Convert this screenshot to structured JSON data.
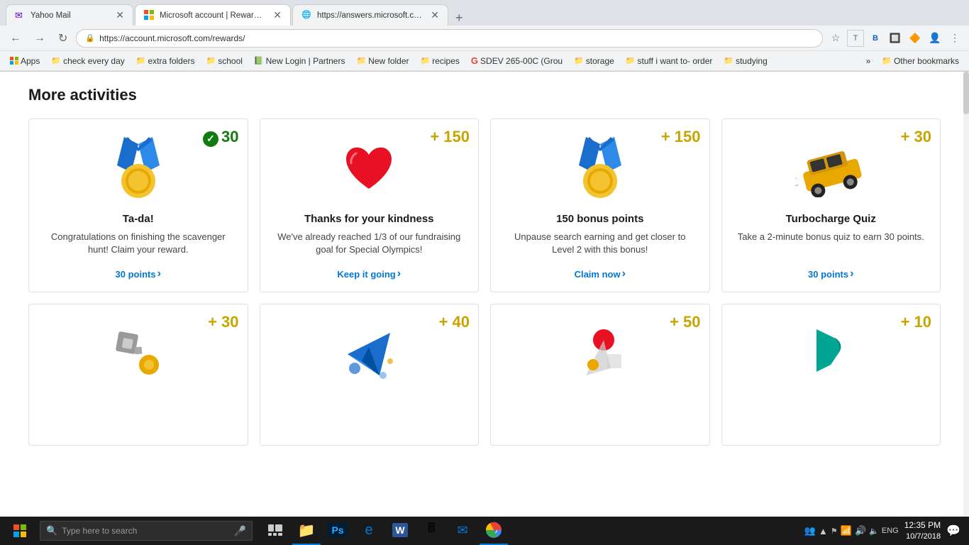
{
  "browser": {
    "tabs": [
      {
        "id": "tab1",
        "title": "Yahoo Mail",
        "favicon": "✉",
        "active": false
      },
      {
        "id": "tab2",
        "title": "Microsoft account | Rewards Das",
        "favicon": "⊞",
        "active": true
      },
      {
        "id": "tab3",
        "title": "https://answers.microsoft.com/e",
        "favicon": "🌐",
        "active": false
      }
    ],
    "address": "https://account.microsoft.com/rewards/",
    "bookmarks": [
      {
        "id": "bm1",
        "label": "Apps",
        "icon": "⊞"
      },
      {
        "id": "bm2",
        "label": "check every day",
        "icon": "📁"
      },
      {
        "id": "bm3",
        "label": "extra folders",
        "icon": "📁"
      },
      {
        "id": "bm4",
        "label": "school",
        "icon": "📁"
      },
      {
        "id": "bm5",
        "label": "New Login | Partners",
        "icon": "📗"
      },
      {
        "id": "bm6",
        "label": "New folder",
        "icon": "📁"
      },
      {
        "id": "bm7",
        "label": "recipes",
        "icon": "📁"
      },
      {
        "id": "bm8",
        "label": "SDEV 265-00C (Grou",
        "icon": "G"
      },
      {
        "id": "bm9",
        "label": "storage",
        "icon": "📁"
      },
      {
        "id": "bm10",
        "label": "stuff i want to- order",
        "icon": "📁"
      },
      {
        "id": "bm11",
        "label": "studying",
        "icon": "📁"
      },
      {
        "id": "bm12",
        "label": "Other bookmarks",
        "icon": "📁"
      }
    ]
  },
  "page": {
    "section_title": "More activities",
    "cards": [
      {
        "id": "card1",
        "points": "30",
        "completed": true,
        "title": "Ta-da!",
        "desc": "Congratulations on finishing the scavenger hunt! Claim your reward.",
        "action_label": "30 points",
        "action_symbol": "›"
      },
      {
        "id": "card2",
        "points": "+ 150",
        "completed": false,
        "title": "Thanks for your kindness",
        "desc": "We've already reached 1/3 of our fundraising goal for Special Olympics!",
        "action_label": "Keep it going",
        "action_symbol": "›"
      },
      {
        "id": "card3",
        "points": "+ 150",
        "completed": false,
        "title": "150 bonus points",
        "desc": "Unpause search earning and get closer to Level 2 with this bonus!",
        "action_label": "Claim now",
        "action_symbol": "›"
      },
      {
        "id": "card4",
        "points": "+ 30",
        "completed": false,
        "title": "Turbocharge Quiz",
        "desc": "Take a 2-minute bonus quiz to earn 30 points.",
        "action_label": "30 points",
        "action_symbol": "›"
      }
    ],
    "bottom_cards": [
      {
        "id": "bcard1",
        "points": "+ 30",
        "title": "",
        "desc": ""
      },
      {
        "id": "bcard2",
        "points": "+ 40",
        "title": "",
        "desc": ""
      },
      {
        "id": "bcard3",
        "points": "+ 50",
        "title": "",
        "desc": ""
      },
      {
        "id": "bcard4",
        "points": "+ 10",
        "title": "",
        "desc": ""
      }
    ]
  },
  "taskbar": {
    "search_placeholder": "Type here to search",
    "clock_time": "12:35 PM",
    "clock_date": "10/7/2018",
    "lang": "ENG"
  }
}
